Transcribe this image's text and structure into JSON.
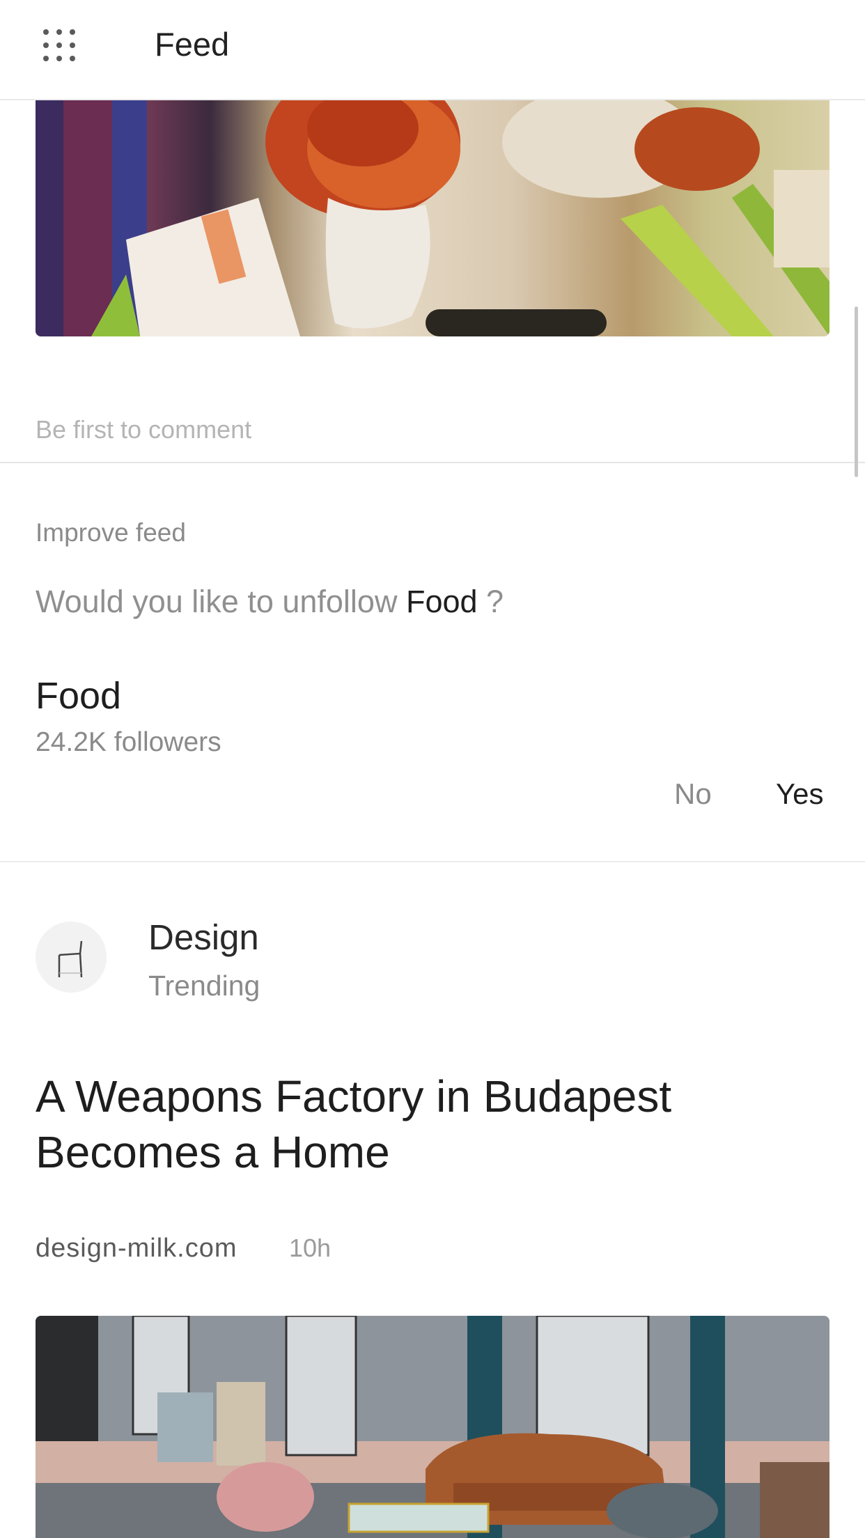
{
  "header": {
    "title": "Feed",
    "menu_icon": "grid-icon"
  },
  "previous_post": {
    "comment_placeholder": "Be first to comment"
  },
  "improve_feed": {
    "label": "Improve feed",
    "question_prefix": "Would you like to unfollow ",
    "question_topic": "Food",
    "question_suffix": " ?",
    "topic_name": "Food",
    "topic_followers": "24.2K followers",
    "no_label": "No",
    "yes_label": "Yes"
  },
  "post": {
    "source_name": "Design",
    "source_sub": "Trending",
    "avatar_icon": "chair-icon",
    "title": "A Weapons Factory in Budapest Becomes a Home",
    "domain": "design-milk.com",
    "age": "10h"
  }
}
